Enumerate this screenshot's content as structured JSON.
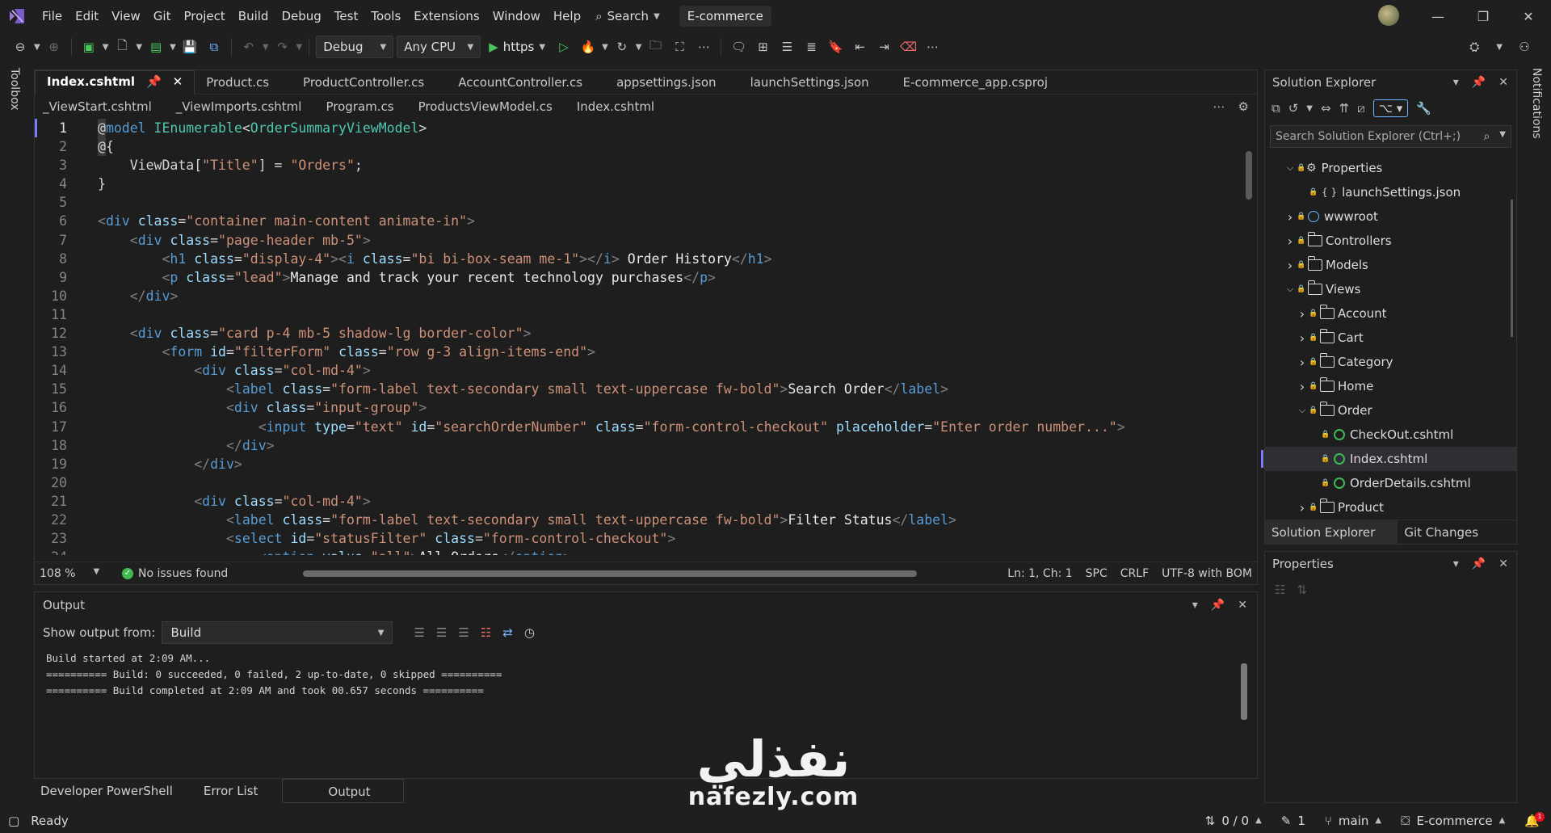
{
  "menu": {
    "items": [
      "File",
      "Edit",
      "View",
      "Git",
      "Project",
      "Build",
      "Debug",
      "Test",
      "Tools",
      "Extensions",
      "Window",
      "Help"
    ],
    "search": "Search",
    "solution_name": "E-commerce"
  },
  "toolbar": {
    "configuration": "Debug",
    "platform": "Any CPU",
    "run_profile": "https"
  },
  "left_strip": {
    "toolbox": "Toolbox"
  },
  "right_strip": {
    "notifications": "Notifications"
  },
  "editor": {
    "tabs_row1": [
      "Index.cshtml",
      "Product.cs",
      "ProductController.cs",
      "AccountController.cs",
      "appsettings.json",
      "launchSettings.json",
      "E-commerce_app.csproj"
    ],
    "tabs_row2": [
      "_ViewStart.cshtml",
      "_ViewImports.cshtml",
      "Program.cs",
      "ProductsViewModel.cs",
      "Index.cshtml"
    ],
    "line_numbers": [
      "1",
      "2",
      "3",
      "4",
      "5",
      "6",
      "7",
      "8",
      "9",
      "10",
      "11",
      "12",
      "13",
      "14",
      "15",
      "16",
      "17",
      "18",
      "19",
      "20",
      "21",
      "22",
      "23",
      "24"
    ],
    "zoom": "108 %",
    "issues": "No issues found",
    "position": "Ln: 1, Ch: 1",
    "whitespace": "SPC",
    "line_ending": "CRLF",
    "encoding": "UTF-8 with BOM"
  },
  "code_lines": [
    [
      [
        "razor",
        "@"
      ],
      [
        "kw",
        "model"
      ],
      [
        "txt",
        " "
      ],
      [
        "type",
        "IEnumerable"
      ],
      [
        "txt",
        "<"
      ],
      [
        "type",
        "OrderSummaryViewModel"
      ],
      [
        "txt",
        ">"
      ]
    ],
    [
      [
        "razor",
        "@"
      ],
      [
        "txt",
        "{"
      ]
    ],
    [
      [
        "txt",
        "    ViewData["
      ],
      [
        "str",
        "\"Title\""
      ],
      [
        "txt",
        "] = "
      ],
      [
        "str",
        "\"Orders\""
      ],
      [
        "txt",
        ";"
      ]
    ],
    [
      [
        "txt",
        "}"
      ]
    ],
    [],
    [
      [
        "punc",
        "<"
      ],
      [
        "tag",
        "div"
      ],
      [
        "txt",
        " "
      ],
      [
        "attr",
        "class"
      ],
      [
        "txt",
        "="
      ],
      [
        "val",
        "\"container main-content animate-in\""
      ],
      [
        "punc",
        ">"
      ]
    ],
    [
      [
        "txt",
        "    "
      ],
      [
        "punc",
        "<"
      ],
      [
        "tag",
        "div"
      ],
      [
        "txt",
        " "
      ],
      [
        "attr",
        "class"
      ],
      [
        "txt",
        "="
      ],
      [
        "val",
        "\"page-header mb-5\""
      ],
      [
        "punc",
        ">"
      ]
    ],
    [
      [
        "txt",
        "        "
      ],
      [
        "punc",
        "<"
      ],
      [
        "tag",
        "h1"
      ],
      [
        "txt",
        " "
      ],
      [
        "attr",
        "class"
      ],
      [
        "txt",
        "="
      ],
      [
        "val",
        "\"display-4\""
      ],
      [
        "punc",
        "><"
      ],
      [
        "tag",
        "i"
      ],
      [
        "txt",
        " "
      ],
      [
        "attr",
        "class"
      ],
      [
        "txt",
        "="
      ],
      [
        "val",
        "\"bi bi-box-seam me-1\""
      ],
      [
        "punc",
        "></"
      ],
      [
        "tag",
        "i"
      ],
      [
        "punc",
        ">"
      ],
      [
        "text",
        " Order History"
      ],
      [
        "punc",
        "</"
      ],
      [
        "tag",
        "h1"
      ],
      [
        "punc",
        ">"
      ]
    ],
    [
      [
        "txt",
        "        "
      ],
      [
        "punc",
        "<"
      ],
      [
        "tag",
        "p"
      ],
      [
        "txt",
        " "
      ],
      [
        "attr",
        "class"
      ],
      [
        "txt",
        "="
      ],
      [
        "val",
        "\"lead\""
      ],
      [
        "punc",
        ">"
      ],
      [
        "text",
        "Manage and track your recent technology purchases"
      ],
      [
        "punc",
        "</"
      ],
      [
        "tag",
        "p"
      ],
      [
        "punc",
        ">"
      ]
    ],
    [
      [
        "txt",
        "    "
      ],
      [
        "punc",
        "</"
      ],
      [
        "tag",
        "div"
      ],
      [
        "punc",
        ">"
      ]
    ],
    [],
    [
      [
        "txt",
        "    "
      ],
      [
        "punc",
        "<"
      ],
      [
        "tag",
        "div"
      ],
      [
        "txt",
        " "
      ],
      [
        "attr",
        "class"
      ],
      [
        "txt",
        "="
      ],
      [
        "val",
        "\"card p-4 mb-5 shadow-lg border-color\""
      ],
      [
        "punc",
        ">"
      ]
    ],
    [
      [
        "txt",
        "        "
      ],
      [
        "punc",
        "<"
      ],
      [
        "tag",
        "form"
      ],
      [
        "txt",
        " "
      ],
      [
        "attr",
        "id"
      ],
      [
        "txt",
        "="
      ],
      [
        "val",
        "\"filterForm\""
      ],
      [
        "txt",
        " "
      ],
      [
        "attr",
        "class"
      ],
      [
        "txt",
        "="
      ],
      [
        "val",
        "\"row g-3 align-items-end\""
      ],
      [
        "punc",
        ">"
      ]
    ],
    [
      [
        "txt",
        "            "
      ],
      [
        "punc",
        "<"
      ],
      [
        "tag",
        "div"
      ],
      [
        "txt",
        " "
      ],
      [
        "attr",
        "class"
      ],
      [
        "txt",
        "="
      ],
      [
        "val",
        "\"col-md-4\""
      ],
      [
        "punc",
        ">"
      ]
    ],
    [
      [
        "txt",
        "                "
      ],
      [
        "punc",
        "<"
      ],
      [
        "tag",
        "label"
      ],
      [
        "txt",
        " "
      ],
      [
        "attr",
        "class"
      ],
      [
        "txt",
        "="
      ],
      [
        "val",
        "\"form-label text-secondary small text-uppercase fw-bold\""
      ],
      [
        "punc",
        ">"
      ],
      [
        "text",
        "Search Order"
      ],
      [
        "punc",
        "</"
      ],
      [
        "tag",
        "label"
      ],
      [
        "punc",
        ">"
      ]
    ],
    [
      [
        "txt",
        "                "
      ],
      [
        "punc",
        "<"
      ],
      [
        "tag",
        "div"
      ],
      [
        "txt",
        " "
      ],
      [
        "attr",
        "class"
      ],
      [
        "txt",
        "="
      ],
      [
        "val",
        "\"input-group\""
      ],
      [
        "punc",
        ">"
      ]
    ],
    [
      [
        "txt",
        "                    "
      ],
      [
        "punc",
        "<"
      ],
      [
        "tag",
        "input"
      ],
      [
        "txt",
        " "
      ],
      [
        "attr",
        "type"
      ],
      [
        "txt",
        "="
      ],
      [
        "val",
        "\"text\""
      ],
      [
        "txt",
        " "
      ],
      [
        "attr",
        "id"
      ],
      [
        "txt",
        "="
      ],
      [
        "val",
        "\"searchOrderNumber\""
      ],
      [
        "txt",
        " "
      ],
      [
        "attr",
        "class"
      ],
      [
        "txt",
        "="
      ],
      [
        "val",
        "\"form-control-checkout\""
      ],
      [
        "txt",
        " "
      ],
      [
        "attr",
        "placeholder"
      ],
      [
        "txt",
        "="
      ],
      [
        "val",
        "\"Enter order number...\""
      ],
      [
        "punc",
        ">"
      ]
    ],
    [
      [
        "txt",
        "                "
      ],
      [
        "punc",
        "</"
      ],
      [
        "tag",
        "div"
      ],
      [
        "punc",
        ">"
      ]
    ],
    [
      [
        "txt",
        "            "
      ],
      [
        "punc",
        "</"
      ],
      [
        "tag",
        "div"
      ],
      [
        "punc",
        ">"
      ]
    ],
    [],
    [
      [
        "txt",
        "            "
      ],
      [
        "punc",
        "<"
      ],
      [
        "tag",
        "div"
      ],
      [
        "txt",
        " "
      ],
      [
        "attr",
        "class"
      ],
      [
        "txt",
        "="
      ],
      [
        "val",
        "\"col-md-4\""
      ],
      [
        "punc",
        ">"
      ]
    ],
    [
      [
        "txt",
        "                "
      ],
      [
        "punc",
        "<"
      ],
      [
        "tag",
        "label"
      ],
      [
        "txt",
        " "
      ],
      [
        "attr",
        "class"
      ],
      [
        "txt",
        "="
      ],
      [
        "val",
        "\"form-label text-secondary small text-uppercase fw-bold\""
      ],
      [
        "punc",
        ">"
      ],
      [
        "text",
        "Filter Status"
      ],
      [
        "punc",
        "</"
      ],
      [
        "tag",
        "label"
      ],
      [
        "punc",
        ">"
      ]
    ],
    [
      [
        "txt",
        "                "
      ],
      [
        "punc",
        "<"
      ],
      [
        "tag",
        "select"
      ],
      [
        "txt",
        " "
      ],
      [
        "attr",
        "id"
      ],
      [
        "txt",
        "="
      ],
      [
        "val",
        "\"statusFilter\""
      ],
      [
        "txt",
        " "
      ],
      [
        "attr",
        "class"
      ],
      [
        "txt",
        "="
      ],
      [
        "val",
        "\"form-control-checkout\""
      ],
      [
        "punc",
        ">"
      ]
    ],
    [
      [
        "txt",
        "                    "
      ],
      [
        "punc",
        "<"
      ],
      [
        "tag",
        "option"
      ],
      [
        "txt",
        " "
      ],
      [
        "attr",
        "value"
      ],
      [
        "txt",
        "="
      ],
      [
        "val",
        "\"all\""
      ],
      [
        "punc",
        ">"
      ],
      [
        "text",
        "All Orders"
      ],
      [
        "punc",
        "</"
      ],
      [
        "tag",
        "option"
      ],
      [
        "punc",
        ">"
      ]
    ]
  ],
  "output": {
    "title": "Output",
    "show_from_label": "Show output from:",
    "source": "Build",
    "lines": [
      "Build started at 2:09 AM...",
      "========== Build: 0 succeeded, 0 failed, 2 up-to-date, 0 skipped ==========",
      "========== Build completed at 2:09 AM and took 00.657 seconds =========="
    ]
  },
  "bottom_tabs": [
    "Developer PowerShell",
    "Error List",
    "Output"
  ],
  "solution_explorer": {
    "title": "Solution Explorer",
    "search_placeholder": "Search Solution Explorer (Ctrl+;)",
    "tree": [
      {
        "label": "Properties",
        "level": 1,
        "expand": "open",
        "icon": "gear"
      },
      {
        "label": "launchSettings.json",
        "level": 2,
        "expand": "none",
        "icon": "json"
      },
      {
        "label": "wwwroot",
        "level": 1,
        "expand": "closed",
        "icon": "globe"
      },
      {
        "label": "Controllers",
        "level": 1,
        "expand": "closed",
        "icon": "folder"
      },
      {
        "label": "Models",
        "level": 1,
        "expand": "closed",
        "icon": "folder"
      },
      {
        "label": "Views",
        "level": 1,
        "expand": "open",
        "icon": "folder"
      },
      {
        "label": "Account",
        "level": 2,
        "expand": "closed",
        "icon": "folder"
      },
      {
        "label": "Cart",
        "level": 2,
        "expand": "closed",
        "icon": "folder"
      },
      {
        "label": "Category",
        "level": 2,
        "expand": "closed",
        "icon": "folder"
      },
      {
        "label": "Home",
        "level": 2,
        "expand": "closed",
        "icon": "folder"
      },
      {
        "label": "Order",
        "level": 2,
        "expand": "open",
        "icon": "folder"
      },
      {
        "label": "CheckOut.cshtml",
        "level": 3,
        "expand": "none",
        "icon": "cshtml"
      },
      {
        "label": "Index.cshtml",
        "level": 3,
        "expand": "none",
        "icon": "cshtml",
        "selected": true
      },
      {
        "label": "OrderDetails.cshtml",
        "level": 3,
        "expand": "none",
        "icon": "cshtml"
      },
      {
        "label": "Product",
        "level": 2,
        "expand": "closed",
        "icon": "folder"
      }
    ],
    "tabs": [
      "Solution Explorer",
      "Git Changes"
    ]
  },
  "properties": {
    "title": "Properties"
  },
  "statusbar": {
    "ready": "Ready",
    "sync": "0 / 0",
    "edits": "1",
    "branch": "main",
    "repo": "E-commerce",
    "notification_count": "1"
  },
  "watermark": {
    "arabic": "نفذلي",
    "url": "nafezly.com"
  },
  "colors": {
    "accent": "#7b7bff",
    "keyword": "#569cd6",
    "type": "#4ec9b0",
    "string": "#ce9178",
    "attribute": "#9cdcfe",
    "success": "#3fb950"
  }
}
